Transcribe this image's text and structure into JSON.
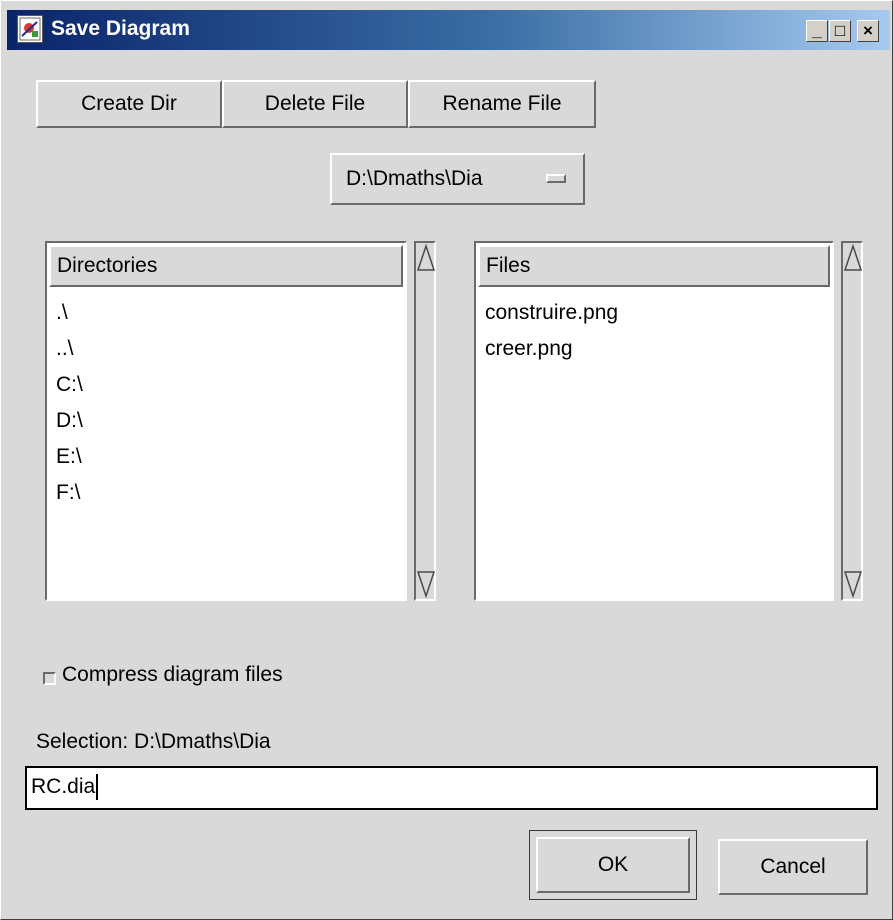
{
  "window": {
    "title": "Save Diagram",
    "controls": {
      "minimize": "_",
      "maximize": "□",
      "close": "×"
    }
  },
  "toolbar": {
    "create_dir": "Create Dir",
    "delete_file": "Delete File",
    "rename_file": "Rename File"
  },
  "path_menu": {
    "value": "D:\\Dmaths\\Dia"
  },
  "directories": {
    "header": "Directories",
    "items": [
      ".\\",
      "..\\",
      "C:\\",
      "D:\\",
      "E:\\",
      "F:\\"
    ]
  },
  "files": {
    "header": "Files",
    "items": [
      "construire.png",
      "creer.png"
    ]
  },
  "compress": {
    "label": "Compress diagram files",
    "checked": false
  },
  "selection": {
    "label": "Selection: D:\\Dmaths\\Dia",
    "value": "RC.dia"
  },
  "actions": {
    "ok": "OK",
    "cancel": "Cancel"
  },
  "icons": {
    "app": "diagram-app-icon",
    "menu_indicator": "option-menu-indicator-icon",
    "scroll_up": "scroll-up-arrow-icon",
    "scroll_down": "scroll-down-arrow-icon"
  }
}
